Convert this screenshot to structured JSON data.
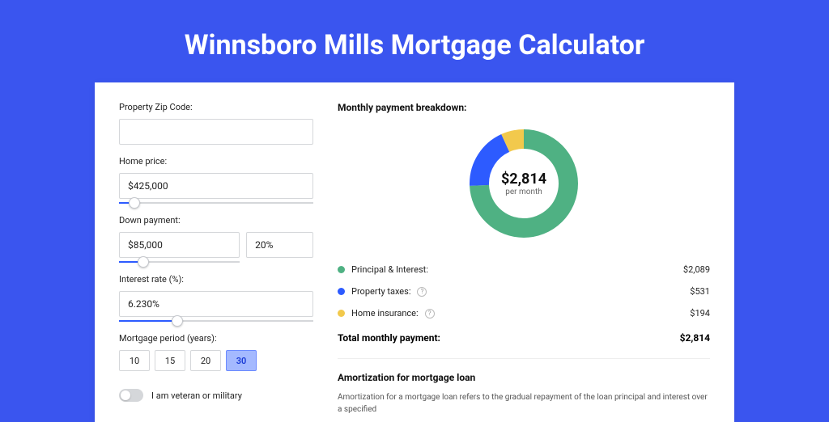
{
  "title": "Winnsboro Mills Mortgage Calculator",
  "form": {
    "zip_label": "Property Zip Code:",
    "zip_value": "",
    "price_label": "Home price:",
    "price_value": "$425,000",
    "price_slider_pct": 8,
    "down_label": "Down payment:",
    "down_value": "$85,000",
    "down_pct_value": "20%",
    "down_slider_pct": 20,
    "rate_label": "Interest rate (%):",
    "rate_value": "6.230%",
    "rate_slider_pct": 30,
    "period_label": "Mortgage period (years):",
    "periods": [
      "10",
      "15",
      "20",
      "30"
    ],
    "period_active_idx": 3,
    "veteran_label": "I am veteran or military"
  },
  "breakdown": {
    "title": "Monthly payment breakdown:",
    "donut_amount": "$2,814",
    "donut_sub": "per month",
    "items": [
      {
        "label": "Principal & Interest:",
        "value": "$2,089",
        "color": "#4fb183",
        "has_help": false
      },
      {
        "label": "Property taxes:",
        "value": "$531",
        "color": "#2d5bff",
        "has_help": true
      },
      {
        "label": "Home insurance:",
        "value": "$194",
        "color": "#f2c94c",
        "has_help": true
      }
    ],
    "total_label": "Total monthly payment:",
    "total_value": "$2,814"
  },
  "amort": {
    "title": "Amortization for mortgage loan",
    "text": "Amortization for a mortgage loan refers to the gradual repayment of the loan principal and interest over a specified"
  },
  "chart_data": {
    "type": "pie",
    "title": "Monthly payment breakdown",
    "series": [
      {
        "name": "Principal & Interest",
        "value": 2089,
        "color": "#4fb183"
      },
      {
        "name": "Property taxes",
        "value": 531,
        "color": "#2d5bff"
      },
      {
        "name": "Home insurance",
        "value": 194,
        "color": "#f2c94c"
      }
    ],
    "total": 2814,
    "center_label": "$2,814 per month"
  }
}
